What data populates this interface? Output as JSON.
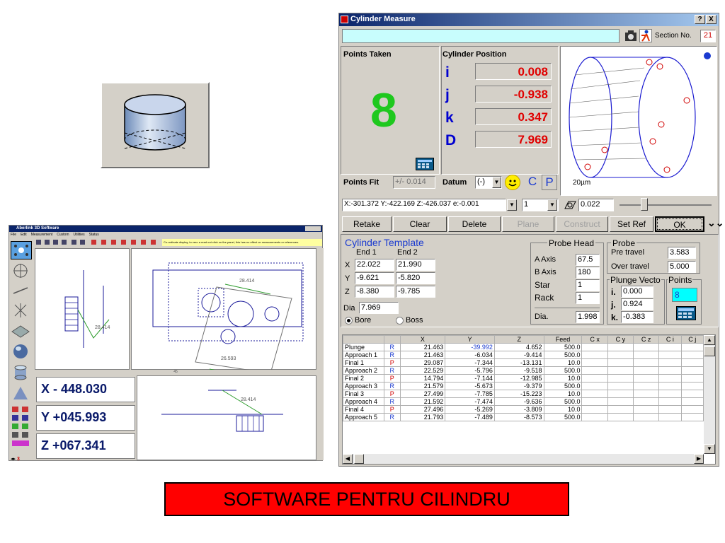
{
  "caption": "SOFTWARE PENTRU CILINDRU",
  "cylinder_measure": {
    "title": "Cylinder Measure",
    "help_button": "?",
    "close_button": "X",
    "section_label": "Section No.",
    "section_value": "21",
    "points_taken_label": "Points Taken",
    "points_taken_value": "8",
    "cylinder_position_label": "Cylinder Position",
    "positions": [
      {
        "axis": "i",
        "value": "0.008"
      },
      {
        "axis": "j",
        "value": "-0.938"
      },
      {
        "axis": "k",
        "value": "0.347"
      },
      {
        "axis": "D",
        "value": "7.969"
      }
    ],
    "points_fit_label": "Points Fit",
    "points_fit_value": "+/- 0.014",
    "datum_label": "Datum",
    "datum_value": "(-)",
    "c_label": "C",
    "p_label": "P",
    "scale_label": "20µm",
    "coord_readout": "X:-301.372 Y:-422.169 Z:-426.037 e:-0.001",
    "coord_select": "1",
    "flatness_value": "0.022",
    "buttons": [
      "Retake",
      "Clear",
      "Delete",
      "Plane",
      "Construct",
      "Set Ref",
      "OK"
    ],
    "template": {
      "title": "Cylinder Template",
      "end1": "End 1",
      "end2": "End 2",
      "rows": [
        {
          "label": "X",
          "e1": "22.022",
          "e2": "21.990"
        },
        {
          "label": "Y",
          "e1": "-9.621",
          "e2": "-5.820"
        },
        {
          "label": "Z",
          "e1": "-8.380",
          "e2": "-9.785"
        }
      ],
      "dia_label": "Dia",
      "dia_value": "7.969",
      "bore_label": "Bore",
      "boss_label": "Boss"
    },
    "probe_head": {
      "title": "Probe Head",
      "a_axis_label": "A Axis",
      "a_axis_value": "67.5",
      "b_axis_label": "B Axis",
      "b_axis_value": "180",
      "star_label": "Star",
      "star_value": "1",
      "rack_label": "Rack",
      "rack_value": "1",
      "dia_label": "Dia.",
      "dia_value": "1.998"
    },
    "probe": {
      "title": "Probe",
      "pre_travel_label": "Pre travel",
      "pre_travel_value": "3.583",
      "over_travel_label": "Over travel",
      "over_travel_value": "5.000"
    },
    "plunge_vector": {
      "title": "Plunge Vecto",
      "i_label": "i.",
      "i_value": "0.000",
      "j_label": "j.",
      "j_value": "0.924",
      "k_label": "k.",
      "k_value": "-0.383"
    },
    "points_box": {
      "title": "Points",
      "value": "8"
    },
    "table": {
      "headers": [
        "",
        "",
        "X",
        "Y",
        "Z",
        "Feed",
        "C x",
        "C y",
        "C z",
        "C i",
        "C j"
      ],
      "rows": [
        [
          "Plunge",
          "R",
          "21.463",
          "-39.992",
          "4.652",
          "500.0"
        ],
        [
          "Approach 1",
          "R",
          "21.463",
          "-6.034",
          "-9.414",
          "500.0"
        ],
        [
          "Final 1",
          "P",
          "29.087",
          "-7.344",
          "-13.131",
          "10.0"
        ],
        [
          "Approach 2",
          "R",
          "22.529",
          "-5.796",
          "-9.518",
          "500.0"
        ],
        [
          "Final 2",
          "P",
          "14.794",
          "-7.144",
          "-12.985",
          "10.0"
        ],
        [
          "Approach 3",
          "R",
          "21.579",
          "-5.673",
          "-9.379",
          "500.0"
        ],
        [
          "Final 3",
          "P",
          "27.499",
          "-7.785",
          "-15.223",
          "10.0"
        ],
        [
          "Approach 4",
          "R",
          "21.592",
          "-7.474",
          "-9.636",
          "500.0"
        ],
        [
          "Final 4",
          "P",
          "27.496",
          "-5.269",
          "-3.809",
          "10.0"
        ],
        [
          "Approach 5",
          "R",
          "21.793",
          "-7.489",
          "-8.573",
          "500.0"
        ]
      ]
    }
  },
  "aberlink": {
    "title": "Aberlink 3D Software",
    "menu": [
      "File",
      "Edit",
      "Measurement",
      "Custom",
      "Utilities",
      "Status"
    ],
    "hint": "Co-ordinate display, to zero a read out click on the panel, this has no effect on measurements or references.",
    "coords": [
      "X - 448.030",
      "Y +045.993",
      "Z +067.341"
    ],
    "dimension_labels": [
      "28.414",
      "28.414",
      "26.593",
      "28.414"
    ],
    "ruler_value": "45",
    "step_value": "3"
  }
}
